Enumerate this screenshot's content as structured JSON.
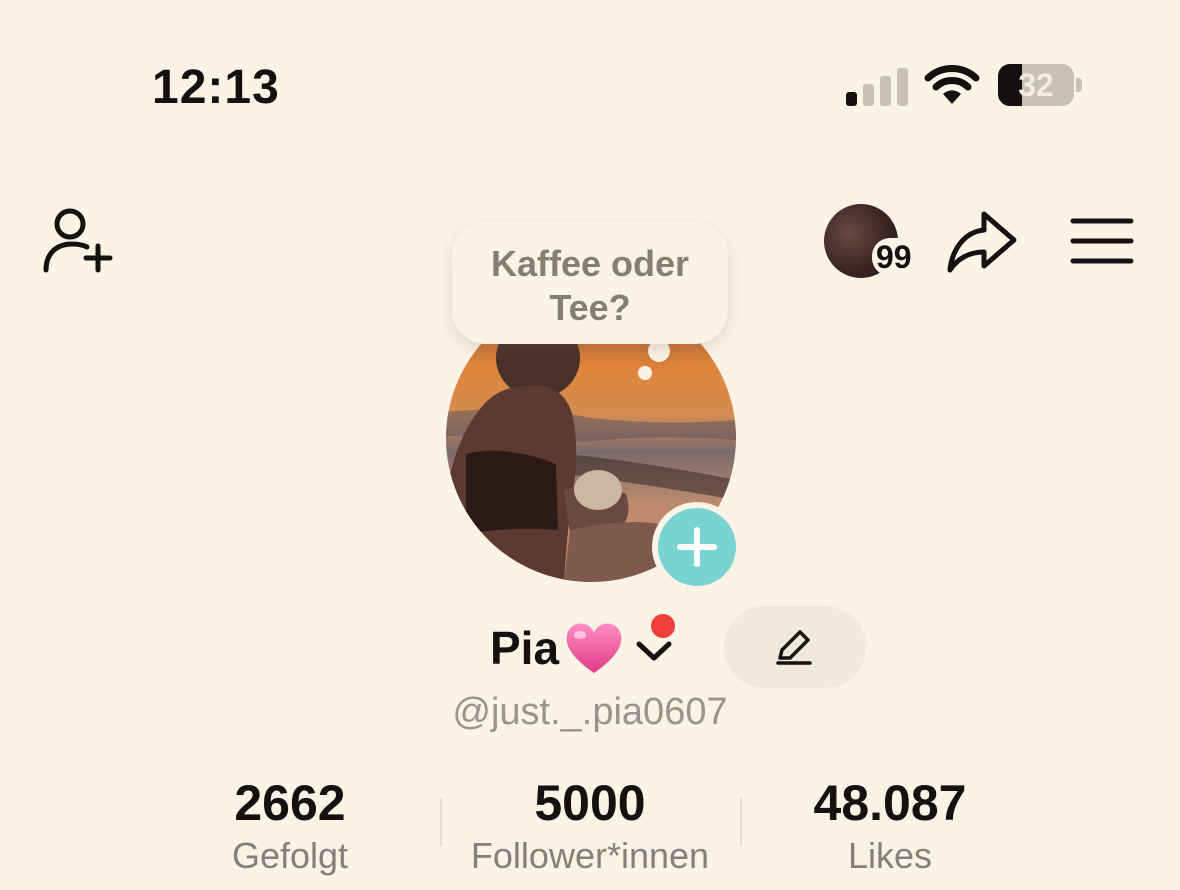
{
  "status_bar": {
    "time": "12:13",
    "battery": "32",
    "battery_level": 0.32,
    "signal_bars": 1
  },
  "header": {
    "visitors_count": "99"
  },
  "note": {
    "text": "Kaffee oder Tee?"
  },
  "profile": {
    "display_name": "Pia",
    "username": "@just._.pia0607"
  },
  "stats": [
    {
      "value": "2662",
      "label": "Gefolgt"
    },
    {
      "value": "5000",
      "label": "Follower*innen"
    },
    {
      "value": "48.087",
      "label": "Likes"
    }
  ],
  "colors": {
    "background": "#fbf3e6",
    "add_story": "#79d3d0",
    "notification_dot": "#f0403c",
    "heart": "#f0569a",
    "text_primary": "#161010",
    "text_secondary": "#86807a"
  },
  "icons": {
    "add_friend": "add-friend-icon",
    "share": "share-icon",
    "menu": "menu-icon",
    "edit": "pencil-icon",
    "add_story": "plus-icon",
    "account_switch": "chevron-down-icon"
  }
}
